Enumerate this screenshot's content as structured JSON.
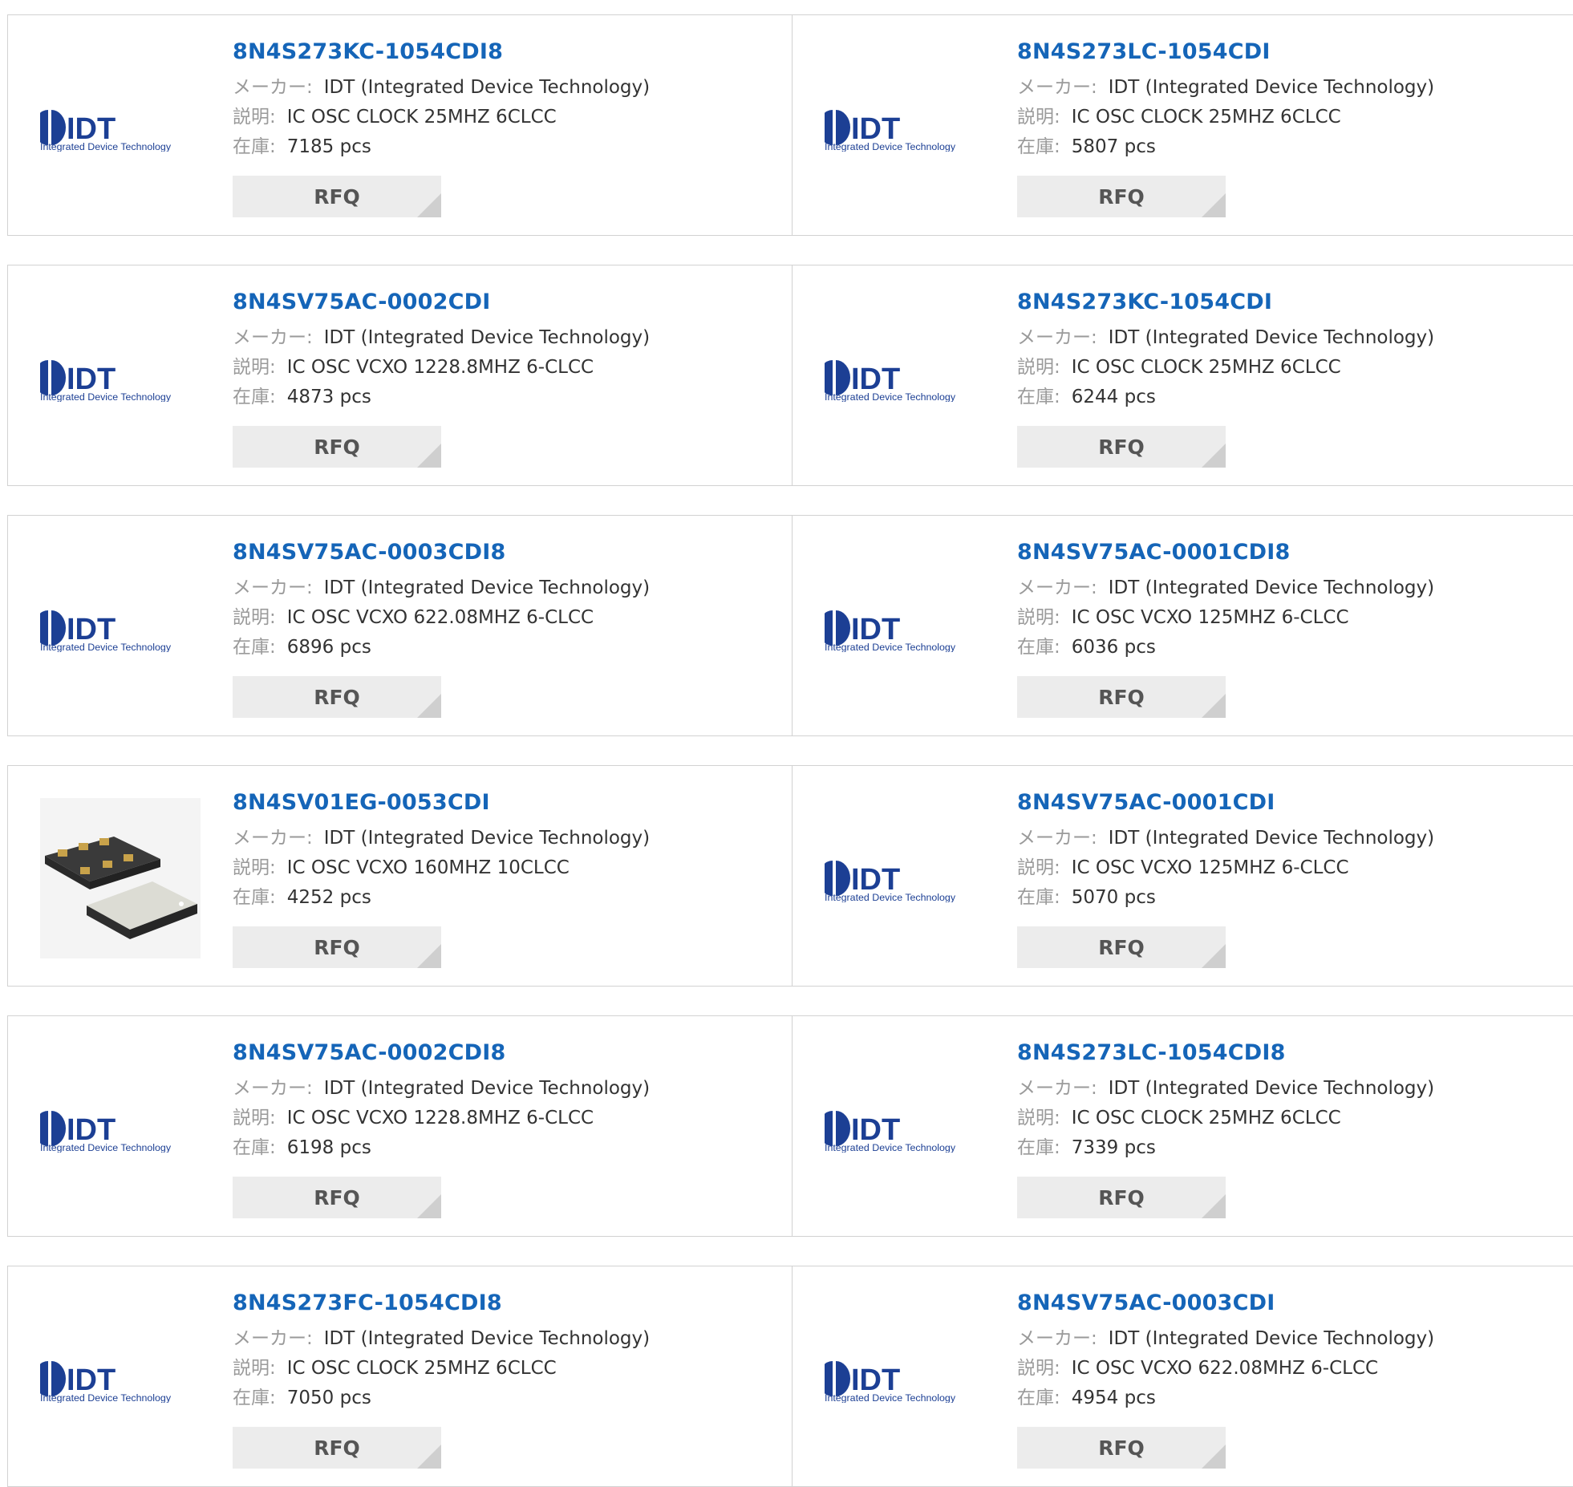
{
  "labels": {
    "maker": "メーカー:",
    "desc": "説明:",
    "stock": "在庫:",
    "rfq": "RFQ"
  },
  "colors": {
    "part_link": "#1565b8",
    "label_gray": "#9a9a9a",
    "rfq_bg": "#ececec",
    "idt_logo": "#1c3f94"
  },
  "logo": {
    "brand": "IDT",
    "tagline": "Integrated Device Technology"
  },
  "products": [
    {
      "part": "8N4S273KC-1054CDI8",
      "maker": "IDT (Integrated Device Technology)",
      "desc": "IC OSC CLOCK 25MHZ 6CLCC",
      "stock": "7185 pcs",
      "image": "idt-logo"
    },
    {
      "part": "8N4S273LC-1054CDI",
      "maker": "IDT (Integrated Device Technology)",
      "desc": "IC OSC CLOCK 25MHZ 6CLCC",
      "stock": "5807 pcs",
      "image": "idt-logo"
    },
    {
      "part": "8N4SV75AC-0002CDI",
      "maker": "IDT (Integrated Device Technology)",
      "desc": "IC OSC VCXO 1228.8MHZ 6-CLCC",
      "stock": "4873 pcs",
      "image": "idt-logo"
    },
    {
      "part": "8N4S273KC-1054CDI",
      "maker": "IDT (Integrated Device Technology)",
      "desc": "IC OSC CLOCK 25MHZ 6CLCC",
      "stock": "6244 pcs",
      "image": "idt-logo"
    },
    {
      "part": "8N4SV75AC-0003CDI8",
      "maker": "IDT (Integrated Device Technology)",
      "desc": "IC OSC VCXO 622.08MHZ 6-CLCC",
      "stock": "6896 pcs",
      "image": "idt-logo"
    },
    {
      "part": "8N4SV75AC-0001CDI8",
      "maker": "IDT (Integrated Device Technology)",
      "desc": "IC OSC VCXO 125MHZ 6-CLCC",
      "stock": "6036 pcs",
      "image": "idt-logo"
    },
    {
      "part": "8N4SV01EG-0053CDI",
      "maker": "IDT (Integrated Device Technology)",
      "desc": "IC OSC VCXO 160MHZ 10CLCC",
      "stock": "4252 pcs",
      "image": "oscillator-photo"
    },
    {
      "part": "8N4SV75AC-0001CDI",
      "maker": "IDT (Integrated Device Technology)",
      "desc": "IC OSC VCXO 125MHZ 6-CLCC",
      "stock": "5070 pcs",
      "image": "idt-logo"
    },
    {
      "part": "8N4SV75AC-0002CDI8",
      "maker": "IDT (Integrated Device Technology)",
      "desc": "IC OSC VCXO 1228.8MHZ 6-CLCC",
      "stock": "6198 pcs",
      "image": "idt-logo"
    },
    {
      "part": "8N4S273LC-1054CDI8",
      "maker": "IDT (Integrated Device Technology)",
      "desc": "IC OSC CLOCK 25MHZ 6CLCC",
      "stock": "7339 pcs",
      "image": "idt-logo"
    },
    {
      "part": "8N4S273FC-1054CDI8",
      "maker": "IDT (Integrated Device Technology)",
      "desc": "IC OSC CLOCK 25MHZ 6CLCC",
      "stock": "7050 pcs",
      "image": "idt-logo"
    },
    {
      "part": "8N4SV75AC-0003CDI",
      "maker": "IDT (Integrated Device Technology)",
      "desc": "IC OSC VCXO 622.08MHZ 6-CLCC",
      "stock": "4954 pcs",
      "image": "idt-logo"
    }
  ]
}
